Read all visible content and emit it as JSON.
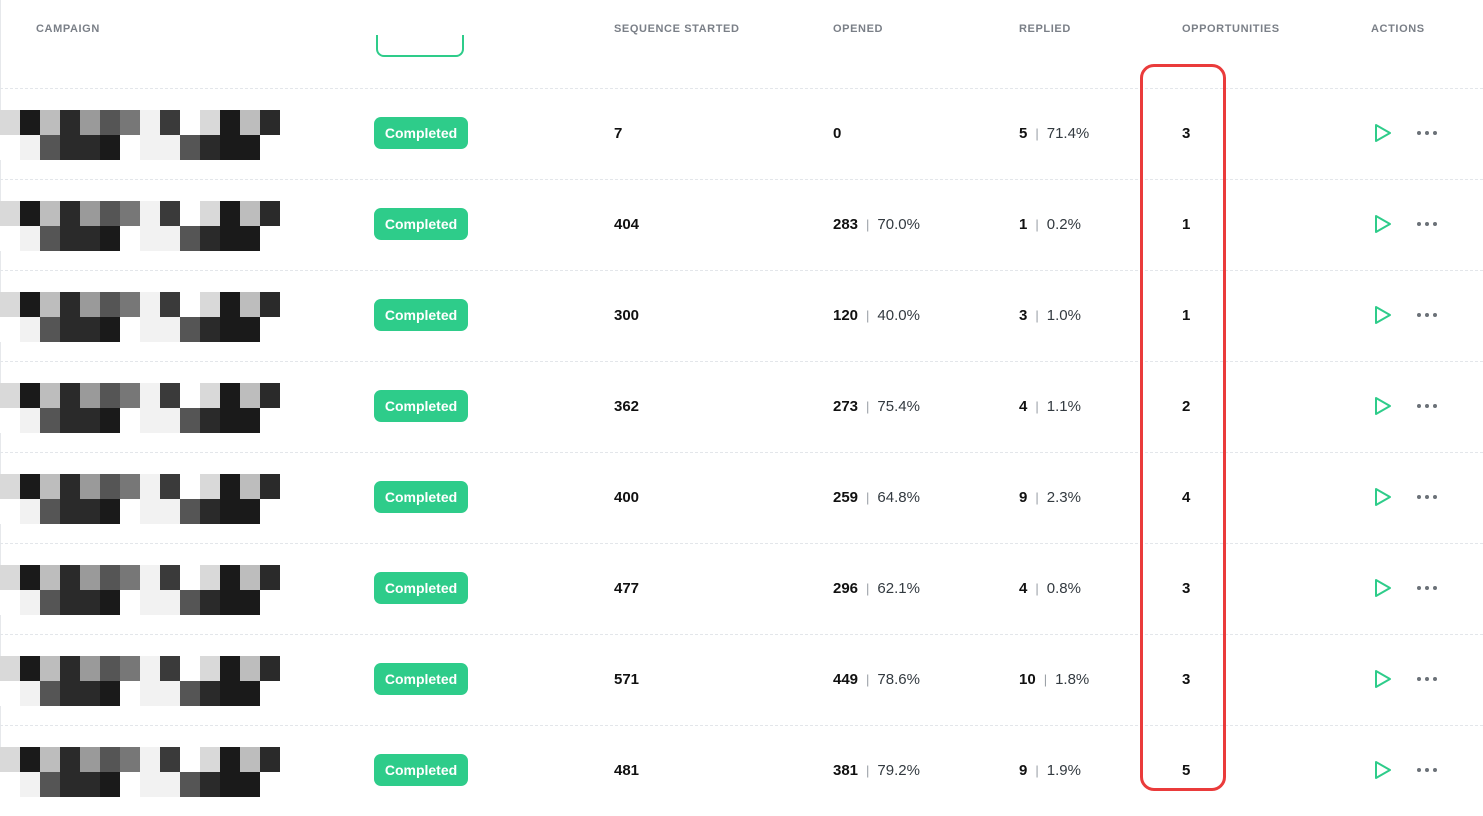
{
  "columns": {
    "campaign": "CAMPAIGN",
    "sequence_started": "SEQUENCE STARTED",
    "opened": "OPENED",
    "replied": "REPLIED",
    "opportunities": "OPPORTUNITIES",
    "actions": "ACTIONS"
  },
  "colors": {
    "status_green": "#2ecc8a",
    "highlight_red": "#ea3b3b",
    "header_gray": "#7a7f87"
  },
  "icons": {
    "play": "play-icon",
    "more": "more-icon"
  },
  "rows": [
    {
      "status": "Completed",
      "sequence_started": "7",
      "opened": "0",
      "opened_pct": "",
      "replied": "5",
      "replied_pct": "71.4%",
      "opportunities": "3"
    },
    {
      "status": "Completed",
      "sequence_started": "404",
      "opened": "283",
      "opened_pct": "70.0%",
      "replied": "1",
      "replied_pct": "0.2%",
      "opportunities": "1"
    },
    {
      "status": "Completed",
      "sequence_started": "300",
      "opened": "120",
      "opened_pct": "40.0%",
      "replied": "3",
      "replied_pct": "1.0%",
      "opportunities": "1"
    },
    {
      "status": "Completed",
      "sequence_started": "362",
      "opened": "273",
      "opened_pct": "75.4%",
      "replied": "4",
      "replied_pct": "1.1%",
      "opportunities": "2"
    },
    {
      "status": "Completed",
      "sequence_started": "400",
      "opened": "259",
      "opened_pct": "64.8%",
      "replied": "9",
      "replied_pct": "2.3%",
      "opportunities": "4"
    },
    {
      "status": "Completed",
      "sequence_started": "477",
      "opened": "296",
      "opened_pct": "62.1%",
      "replied": "4",
      "replied_pct": "0.8%",
      "opportunities": "3"
    },
    {
      "status": "Completed",
      "sequence_started": "571",
      "opened": "449",
      "opened_pct": "78.6%",
      "replied": "10",
      "replied_pct": "1.8%",
      "opportunities": "3"
    },
    {
      "status": "Completed",
      "sequence_started": "481",
      "opened": "381",
      "opened_pct": "79.2%",
      "replied": "9",
      "replied_pct": "1.9%",
      "opportunities": "5"
    }
  ]
}
